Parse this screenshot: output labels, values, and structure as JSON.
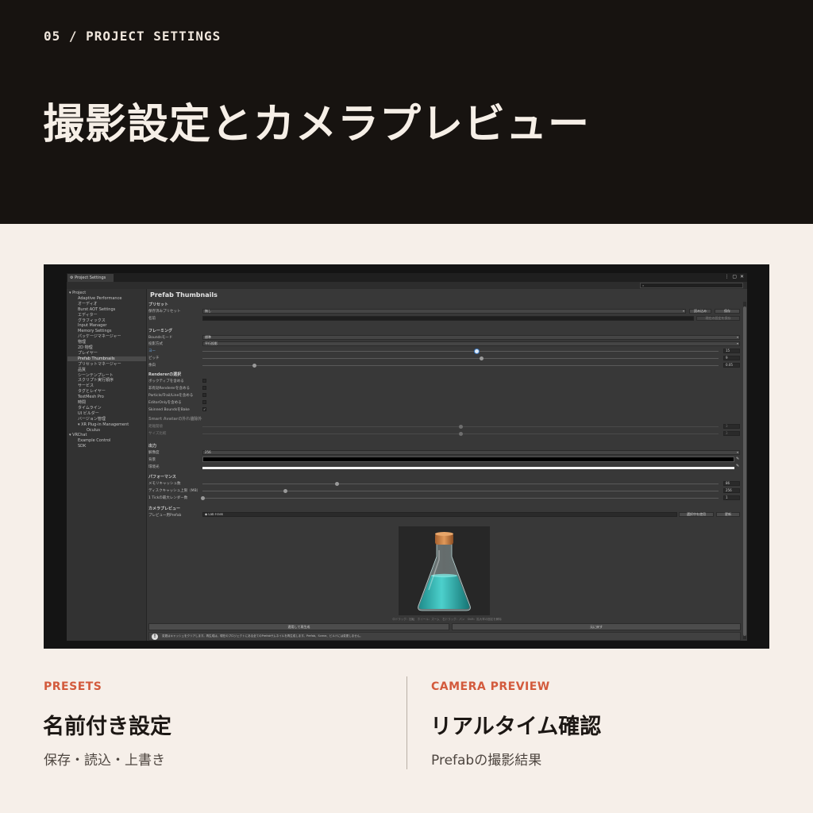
{
  "header": {
    "eyebrow": "05 / PROJECT SETTINGS",
    "title": "撮影設定とカメラプレビュー"
  },
  "window": {
    "tab_label": "Project Settings",
    "search_placeholder": "",
    "controls": "⋮ ▢ ✕"
  },
  "sidebar": {
    "items": [
      {
        "label": "▾ Project",
        "indent": 0,
        "selected": false
      },
      {
        "label": "Adaptive Performance",
        "indent": 1,
        "selected": false
      },
      {
        "label": "オーディオ",
        "indent": 1,
        "selected": false
      },
      {
        "label": "Burst AOT Settings",
        "indent": 1,
        "selected": false
      },
      {
        "label": "エディター",
        "indent": 1,
        "selected": false
      },
      {
        "label": "グラフィックス",
        "indent": 1,
        "selected": false
      },
      {
        "label": "Input Manager",
        "indent": 1,
        "selected": false
      },
      {
        "label": "Memory Settings",
        "indent": 1,
        "selected": false
      },
      {
        "label": "パッケージマネージャー",
        "indent": 1,
        "selected": false
      },
      {
        "label": "物理",
        "indent": 1,
        "selected": false
      },
      {
        "label": "2D 物理",
        "indent": 1,
        "selected": false
      },
      {
        "label": "プレイヤー",
        "indent": 1,
        "selected": false
      },
      {
        "label": "Prefab Thumbnails",
        "indent": 1,
        "selected": true
      },
      {
        "label": "プリセットマネージャー",
        "indent": 1,
        "selected": false
      },
      {
        "label": "品質",
        "indent": 1,
        "selected": false
      },
      {
        "label": "シーンテンプレート",
        "indent": 1,
        "selected": false
      },
      {
        "label": "スクリプト実行順序",
        "indent": 1,
        "selected": false
      },
      {
        "label": "サービス",
        "indent": 1,
        "selected": false
      },
      {
        "label": "タグとレイヤー",
        "indent": 1,
        "selected": false
      },
      {
        "label": "TextMesh Pro",
        "indent": 1,
        "selected": false
      },
      {
        "label": "時間",
        "indent": 1,
        "selected": false
      },
      {
        "label": "タイムライン",
        "indent": 1,
        "selected": false
      },
      {
        "label": "UI ビルダー",
        "indent": 1,
        "selected": false
      },
      {
        "label": "バージョン管理",
        "indent": 1,
        "selected": false
      },
      {
        "label": "▾ XR Plug-in Management",
        "indent": 1,
        "selected": false
      },
      {
        "label": "Oculus",
        "indent": 2,
        "selected": false
      },
      {
        "label": "▾ VRChat",
        "indent": 0,
        "selected": false
      },
      {
        "label": "Example Control",
        "indent": 1,
        "selected": false
      },
      {
        "label": "SDK",
        "indent": 1,
        "selected": false
      }
    ]
  },
  "panel": {
    "title": "Prefab Thumbnails",
    "presets": {
      "section": "プリセット",
      "saved_label": "保存済みプリセット",
      "saved_value": "無し",
      "load_button": "読み込み",
      "save_button": "保存",
      "name_label": "名前",
      "name_value": "",
      "overwrite_button": "現在の設定を保存"
    },
    "framing": {
      "section": "フレーミング",
      "bounds_label": "Boundsモード",
      "bounds_value": "標準",
      "projection_label": "投影方式",
      "projection_value": "平行投影",
      "yaw_label": "ヨー",
      "yaw_value": "15",
      "yaw_fraction": 0.53,
      "pitch_label": "ピッチ",
      "pitch_value": "9",
      "pitch_fraction": 0.54,
      "margin_label": "余白",
      "margin_value": "0.05",
      "margin_fraction": 0.1
    },
    "renderer": {
      "section": "Rendererの選択",
      "items": [
        {
          "label": "ボックティブを含める",
          "checked": false
        },
        {
          "label": "非有効Rendererを含める",
          "checked": false
        },
        {
          "label": "Particle/Trail/Lineを含める",
          "checked": false
        },
        {
          "label": "EditorOnlyを含める",
          "checked": false
        },
        {
          "label": "Skinned BoundsをBake",
          "checked": true
        }
      ]
    },
    "smart_avatar": {
      "section": "Smart Avatarの外れ値除外",
      "threshold_label": "距離閾値",
      "threshold_value": "3",
      "threshold_fraction": 0.5,
      "size_label": "サイズ比較",
      "size_value": "3",
      "size_fraction": 0.5
    },
    "output": {
      "section": "出力",
      "resolution_label": "解像度",
      "resolution_value": "256",
      "background_label": "背景",
      "background_color": "#000000",
      "ambient_label": "環境光",
      "ambient_color": "#f4f4f4",
      "picker_glyph": "✎"
    },
    "performance": {
      "section": "パフォーマンス",
      "memory_label": "メモリキャッシュ数",
      "memory_value": "86",
      "memory_fraction": 0.26,
      "disk_label": "ディスクキャッシュ上限（MB）",
      "disk_value": "256",
      "disk_fraction": 0.16,
      "tick_label": "1 Tickの最大レンダー数",
      "tick_value": "1",
      "tick_fraction": 0.0
    },
    "camera_preview": {
      "section": "カメラプレビュー",
      "prefab_label": "プレビュー用Prefab",
      "prefab_value": "◆ Lab Flask",
      "use_selection_button": "選択中を使用",
      "refresh_button": "更新",
      "caption": "中ドラッグ：回転　ホイール：ズーム　右ドラッグ：パン　Shift：拡大率の固定を解除",
      "render_button": "適用して再生成",
      "reset_button": "元に戻す"
    },
    "help_text": "変更はキャッシュをクリアします。再生成は、現在のプロジェクトにある全てのPrefabサムネイルを再生成します。Prefab、Scene、ビルドには変更しません。",
    "help_icon": "!"
  },
  "features": [
    {
      "tag": "PRESETS",
      "title": "名前付き設定",
      "subtitle": "保存・読込・上書き"
    },
    {
      "tag": "CAMERA PREVIEW",
      "title": "リアルタイム確認",
      "subtitle": "Prefabの撮影結果"
    }
  ]
}
